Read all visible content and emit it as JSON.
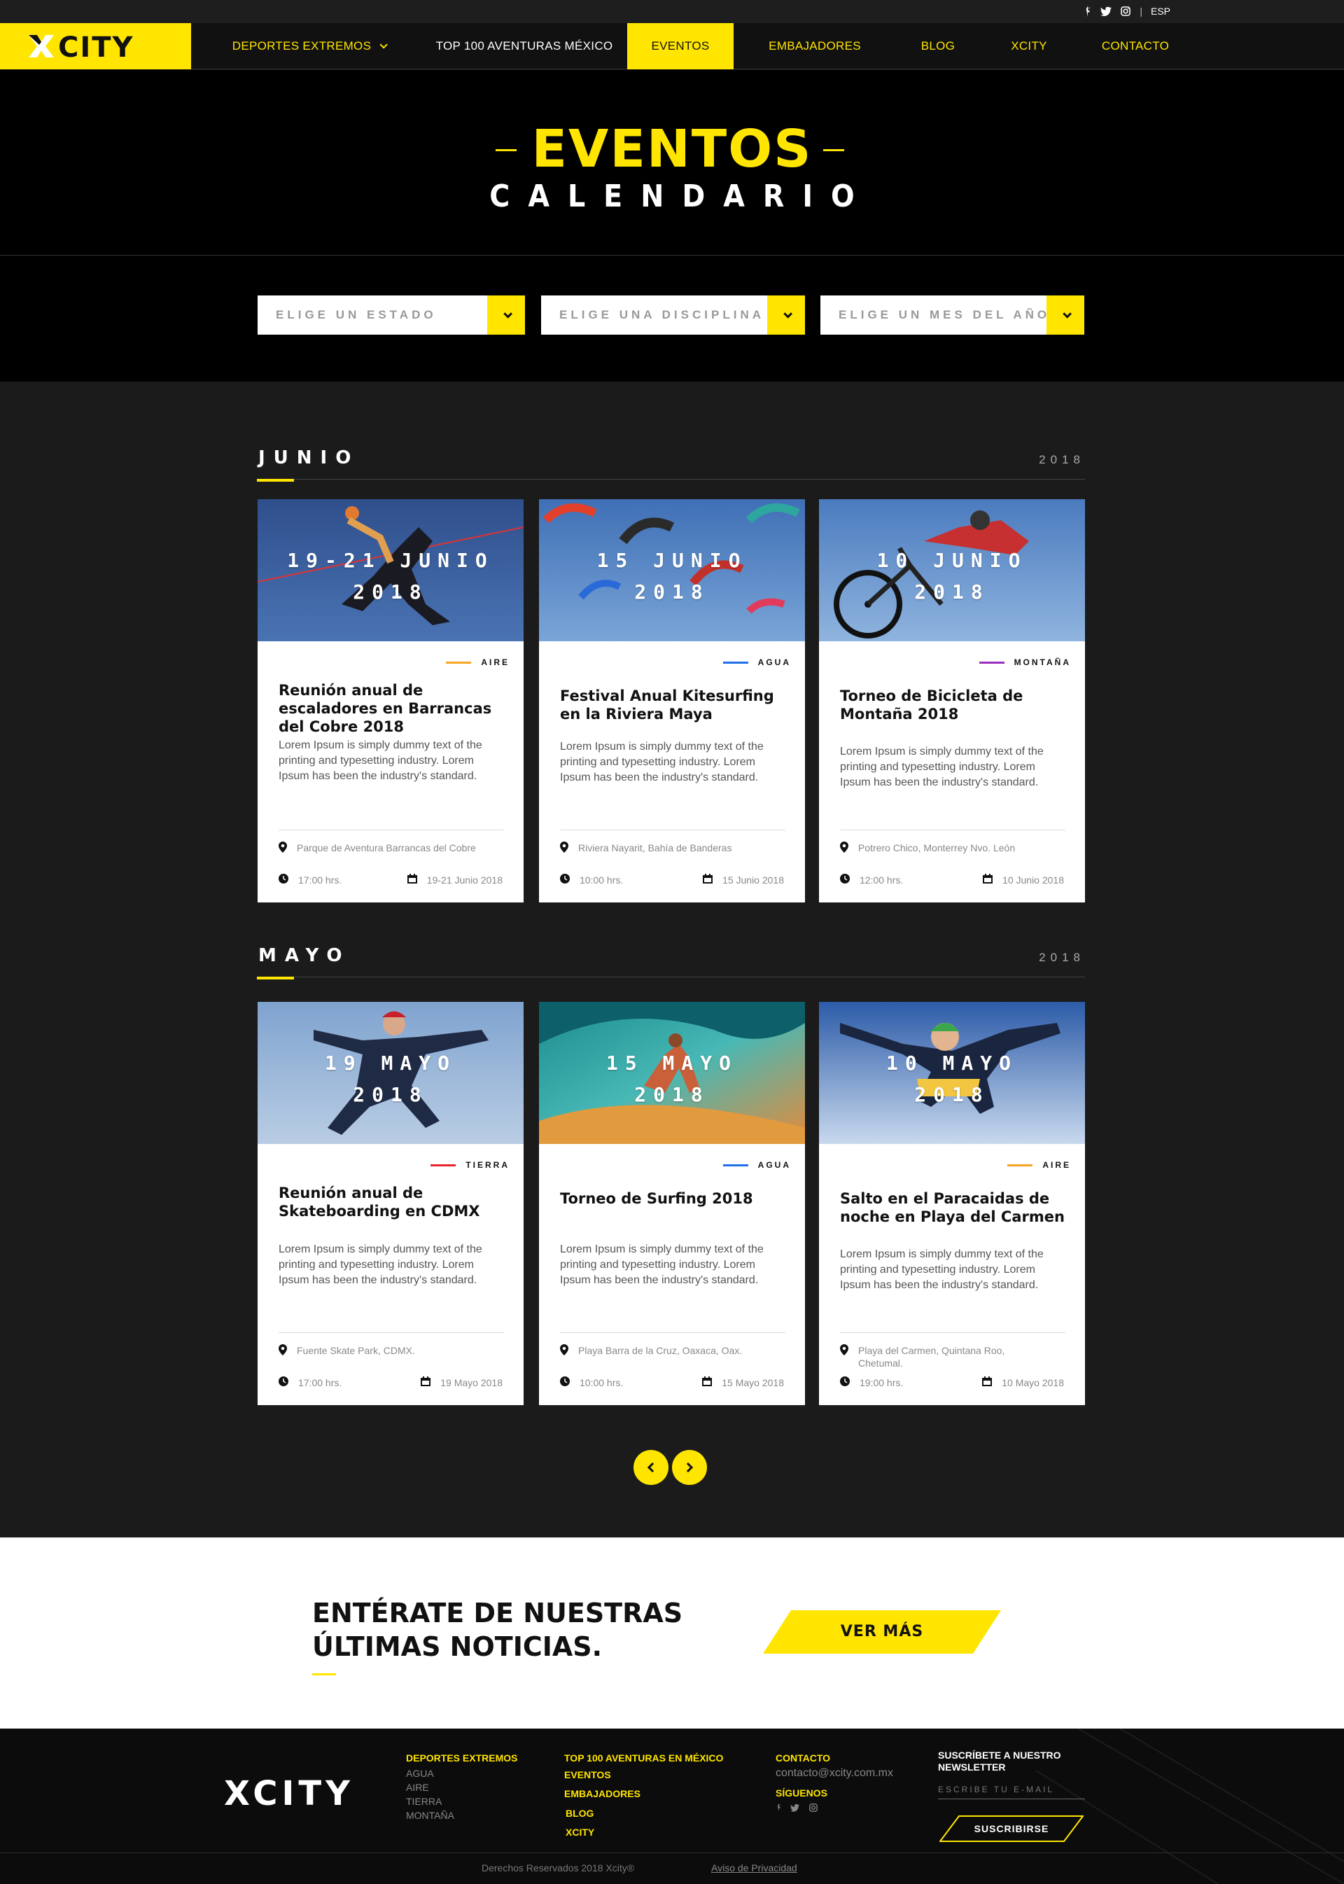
{
  "utilbar": {
    "lang": "ESP",
    "separator": "|"
  },
  "brand": {
    "logo": "XCITY",
    "accent": "#ffe500"
  },
  "nav": {
    "items": [
      {
        "label": "DEPORTES EXTREMOS"
      },
      {
        "label": "TOP 100 AVENTURAS MÉXICO"
      },
      {
        "label": "EVENTOS"
      },
      {
        "label": "EMBAJADORES"
      },
      {
        "label": "BLOG"
      },
      {
        "label": "XCITY"
      },
      {
        "label": "CONTACTO"
      }
    ]
  },
  "hero": {
    "title": "EVENTOS",
    "subtitle": "CALENDARIO"
  },
  "filters": {
    "estado": "ELIGE UN ESTADO",
    "disciplina": "ELIGE UNA DISCIPLINA",
    "mes": "ELIGE UN MES DEL AÑO"
  },
  "months": [
    {
      "name": "JUNIO",
      "year": "2018",
      "events": [
        {
          "date_line1": "19-21 JUNIO",
          "date_line2": "2018",
          "category": "AIRE",
          "category_color": "#f5a623",
          "title": "Reunión anual de escaladores en Barrancas del Cobre 2018",
          "desc": "Lorem Ipsum is simply dummy text of the printing and typesetting industry. Lorem Ipsum has been the industry's standard.",
          "location": "Parque de Aventura Barrancas del Cobre",
          "time": "17:00 hrs.",
          "date": "19-21 Junio 2018"
        },
        {
          "date_line1": "15 JUNIO",
          "date_line2": "2018",
          "category": "AGUA",
          "category_color": "#1e6fe8",
          "title": "Festival Anual Kitesurfing en la Riviera Maya",
          "desc": "Lorem Ipsum is simply dummy text of the printing and typesetting industry. Lorem Ipsum has been the industry's standard.",
          "location": "Riviera Nayarit, Bahía de Banderas",
          "time": "10:00 hrs.",
          "date": "15 Junio 2018"
        },
        {
          "date_line1": "10 JUNIO",
          "date_line2": "2018",
          "category": "MONTAÑA",
          "category_color": "#9b2dbd",
          "title": "Torneo de Bicicleta de Montaña 2018",
          "desc": "Lorem Ipsum is simply dummy text of the printing and typesetting industry. Lorem Ipsum has been the industry's standard.",
          "location": "Potrero Chico, Monterrey Nvo. León",
          "time": "12:00 hrs.",
          "date": "10 Junio 2018"
        }
      ]
    },
    {
      "name": "MAYO",
      "year": "2018",
      "events": [
        {
          "date_line1": "19 MAYO",
          "date_line2": "2018",
          "category": "TIERRA",
          "category_color": "#e8232a",
          "title": "Reunión anual de Skateboarding en CDMX",
          "desc": "Lorem Ipsum is simply dummy text of the printing and typesetting industry. Lorem Ipsum has been the industry's standard.",
          "location": "Fuente Skate Park, CDMX.",
          "time": "17:00 hrs.",
          "date": "19 Mayo 2018"
        },
        {
          "date_line1": "15 MAYO",
          "date_line2": "2018",
          "category": "AGUA",
          "category_color": "#1e6fe8",
          "title": "Torneo de Surfing 2018",
          "desc": "Lorem Ipsum is simply dummy text of the printing and typesetting industry. Lorem Ipsum has been the industry's standard.",
          "location": "Playa Barra de la Cruz, Oaxaca, Oax.",
          "time": "10:00 hrs.",
          "date": "15 Mayo 2018"
        },
        {
          "date_line1": "10 MAYO",
          "date_line2": "2018",
          "category": "AIRE",
          "category_color": "#f5a623",
          "title": "Salto en el Paracaidas de noche en Playa del Carmen",
          "desc": "Lorem Ipsum is simply dummy text of the printing and typesetting industry. Lorem Ipsum has been the industry's standard.",
          "location": "Playa del Carmen, Quintana Roo, Chetumal.",
          "time": "19:00 hrs.",
          "date": "10 Mayo 2018"
        }
      ]
    }
  ],
  "cta": {
    "title_line1": "ENTÉRATE DE NUESTRAS",
    "title_line2": "ÚLTIMAS NOTICIAS.",
    "button": "VER MÁS"
  },
  "footer": {
    "logo": "XCITY",
    "col1_head": "DEPORTES EXTREMOS",
    "col1_items": [
      "AGUA",
      "AIRE",
      "TIERRA",
      "MONTAÑA"
    ],
    "col2_items": [
      "TOP 100 AVENTURAS EN MÉXICO",
      "EVENTOS",
      "EMBAJADORES",
      "BLOG",
      "XCITY"
    ],
    "contact_head": "CONTACTO",
    "contact_email": "contacto@xcity.com.mx",
    "follow_head": "SÍGUENOS",
    "newsletter_head": "SUSCRÍBETE A NUESTRO NEWSLETTER",
    "email_placeholder": "ESCRIBE TU E-MAIL",
    "subscribe": "SUSCRIBIRSE",
    "copyright": "Derechos Reservados 2018 Xcity®",
    "privacy": "Aviso de Privacidad"
  }
}
